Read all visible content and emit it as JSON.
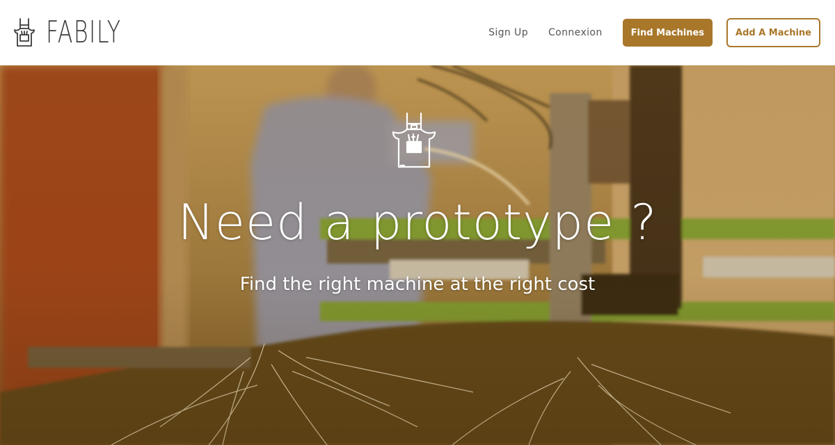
{
  "brand": {
    "name": "FABILY",
    "logo_icon": "apron-icon"
  },
  "nav": {
    "sign_up": "Sign Up",
    "connexion": "Connexion",
    "find_machines": "Find Machines",
    "add_machine": "Add A Machine"
  },
  "hero": {
    "icon": "apron-tools-icon",
    "title": "Need a prototype ?",
    "subtitle": "Find the right machine at the right cost"
  },
  "colors": {
    "accent": "#a8772a",
    "text_dark": "#3b3b3b",
    "hero_text": "#ffffff"
  }
}
